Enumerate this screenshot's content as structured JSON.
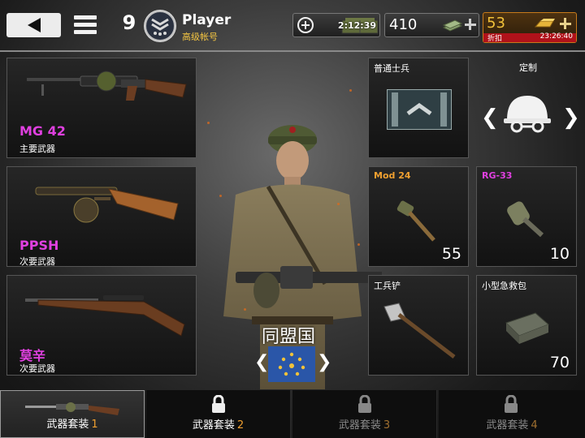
{
  "header": {
    "player_level": "9",
    "player_name": "Player",
    "account_type": "高级帐号",
    "timer": "2:12:39",
    "money": "410",
    "gold": "53",
    "discount_label": "折扣",
    "discount_timer": "23:26:40"
  },
  "weapons": [
    {
      "name": "MG 42",
      "slot": "主要武器",
      "icon": "machine-gun-icon"
    },
    {
      "name": "PPSH",
      "slot": "次要武器",
      "icon": "smg-icon"
    },
    {
      "name": "莫辛",
      "slot": "次要武器",
      "icon": "rifle-icon"
    }
  ],
  "character": {
    "class_label": "普通士兵",
    "custom_label": "定制"
  },
  "items": [
    {
      "name": "Mod 24",
      "count": "55",
      "icon": "stick-grenade-icon"
    },
    {
      "name": "RG-33",
      "count": "10",
      "icon": "grenade-icon"
    },
    {
      "name": "工兵铲",
      "count": "",
      "icon": "shovel-icon"
    },
    {
      "name": "小型急救包",
      "count": "70",
      "icon": "medkit-icon"
    }
  ],
  "faction": {
    "name": "同盟国"
  },
  "loadout_tabs": [
    {
      "label": "武器套装",
      "number": "1",
      "locked": false
    },
    {
      "label": "武器套装",
      "number": "2",
      "locked": true
    },
    {
      "label": "武器套装",
      "number": "3",
      "locked": true
    },
    {
      "label": "武器套装",
      "number": "4",
      "locked": true
    }
  ],
  "colors": {
    "weapon_name": "#e040e0",
    "item_orange": "#f0a030",
    "gold": "#f2c23a",
    "discount_red": "#b0121a"
  }
}
